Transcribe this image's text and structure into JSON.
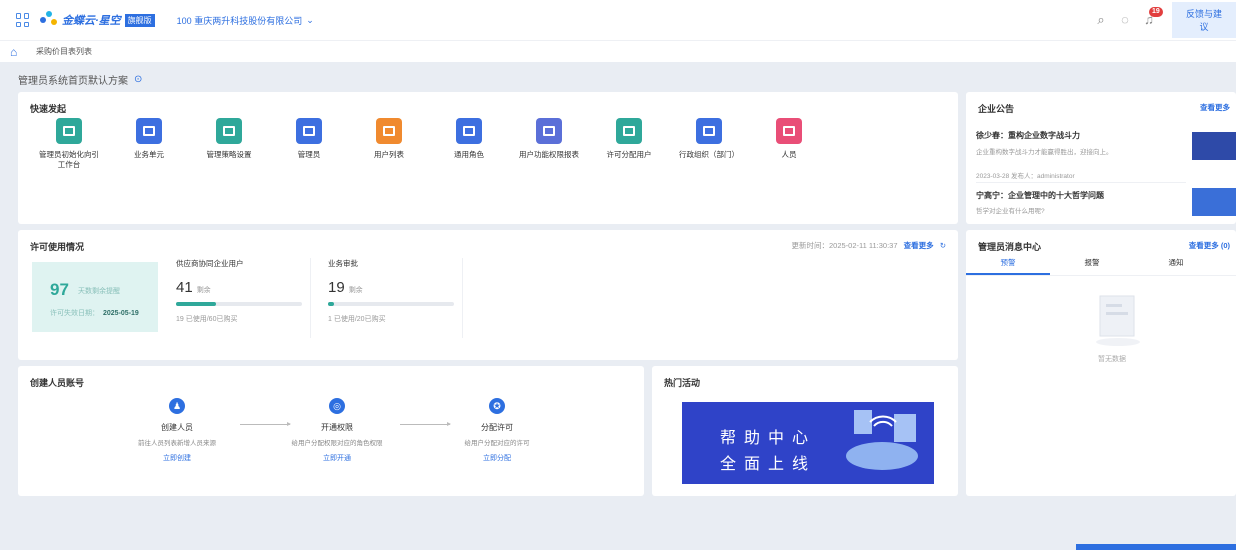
{
  "header": {
    "logo_text": "金蝶云·星空",
    "badge": "旗舰版",
    "company": "100 重庆两升科技股份有限公司",
    "notify_count": "19",
    "feedback": "反馈与建议"
  },
  "breadcrumb": {
    "item": "采购价目表列表"
  },
  "page_title": "管理员系统首页默认方案",
  "quick": {
    "title": "快速发起",
    "items": [
      {
        "label": "管理员初始化向引工作台",
        "color": "#2fa89a"
      },
      {
        "label": "业务单元",
        "color": "#3d6fe0"
      },
      {
        "label": "管理策略设置",
        "color": "#2fa89a"
      },
      {
        "label": "管理员",
        "color": "#3d6fe0"
      },
      {
        "label": "用户列表",
        "color": "#f08a2f"
      },
      {
        "label": "通用角色",
        "color": "#3d6fe0"
      },
      {
        "label": "用户功能权限报表",
        "color": "#5b6fd8"
      },
      {
        "label": "许可分配用户",
        "color": "#2fa89a"
      },
      {
        "label": "行政组织（部门）",
        "color": "#3d6fe0"
      },
      {
        "label": "人员",
        "color": "#e94e77"
      }
    ]
  },
  "license": {
    "title": "许可使用情况",
    "update_time": "更新时间：2025-02-11 11:30:37",
    "more": "查看更多",
    "days": "97",
    "days_unit": "天数剩余提醒",
    "expire_label": "许可失效日期：",
    "expire_date": "2025-05-19",
    "stats": [
      {
        "name": "供应商协同企业用户",
        "value": "41",
        "unit": "剩余",
        "used": "19 已使用/60已购买",
        "fill": 0.32
      },
      {
        "name": "业务审批",
        "value": "19",
        "unit": "剩余",
        "used": "1 已使用/20已购买",
        "fill": 0.05
      }
    ]
  },
  "create": {
    "title": "创建人员账号",
    "steps": [
      {
        "title": "创建人员",
        "desc": "前往人员列表新增人员来源",
        "link": "立即创建"
      },
      {
        "title": "开通权限",
        "desc": "给用户分配权限对应的角色权限",
        "link": "立即开通"
      },
      {
        "title": "分配许可",
        "desc": "给用户分配对应的许可",
        "link": "立即分配"
      }
    ]
  },
  "hot": {
    "title": "热门活动",
    "line1": "帮助中心",
    "line2": "全面上线"
  },
  "announce": {
    "title": "企业公告",
    "more": "查看更多",
    "items": [
      {
        "title": "徐少春：重构企业数字战斗力",
        "summary": "企业重构数字战斗力才能赢得胜出，迎接向上。",
        "meta": "2023-03-28  发布人：administrator"
      },
      {
        "title": "宁高宁：企业管理中的十大哲学问题",
        "summary": "哲学对企业有什么用呢?",
        "meta": ""
      }
    ]
  },
  "message": {
    "title": "管理员消息中心",
    "more": "查看更多 (0)",
    "tabs": [
      "预警",
      "报警",
      "通知"
    ],
    "empty": "暂无数据"
  }
}
